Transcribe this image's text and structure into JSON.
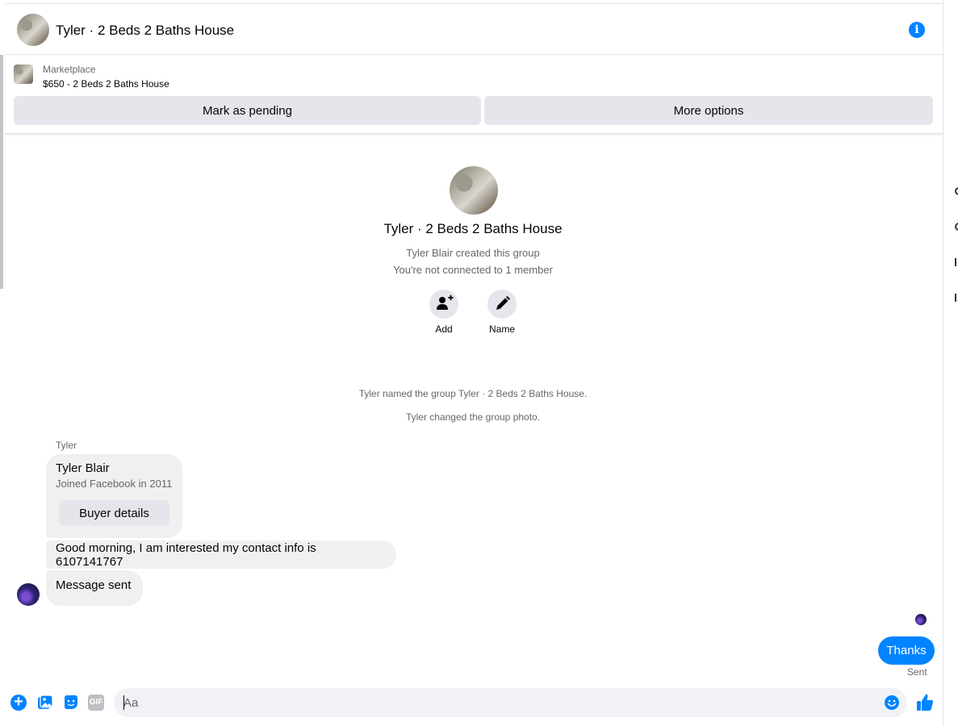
{
  "header": {
    "title": "Tyler · 2 Beds 2 Baths House"
  },
  "marketplace": {
    "label": "Marketplace",
    "item": "$650 - 2 Beds 2 Baths House",
    "mark_pending_label": "Mark as pending",
    "more_options_label": "More options"
  },
  "intro": {
    "title": "Tyler · 2 Beds 2 Baths House",
    "created_by": "Tyler Blair created this group",
    "connection": "You're not connected to 1 member",
    "add_label": "Add",
    "name_label": "Name"
  },
  "system_messages": [
    "Tyler named the group Tyler · 2 Beds 2 Baths House.",
    "Tyler changed the group photo."
  ],
  "conversation": {
    "sender_name": "Tyler",
    "buyer_card": {
      "name": "Tyler Blair",
      "joined": "Joined Facebook in 2011",
      "button_label": "Buyer details"
    },
    "incoming": [
      "Good morning, I am interested my contact info is 6107141767",
      "Message sent"
    ],
    "outgoing": "Thanks",
    "status": "Sent"
  },
  "composer": {
    "placeholder": "Aa",
    "value": "",
    "gif_label": "GIF",
    "accent_color": "#0084ff"
  }
}
